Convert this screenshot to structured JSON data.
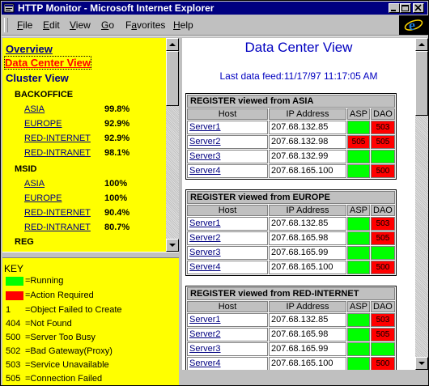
{
  "window": {
    "title": "HTTP Monitor - Microsoft Internet Explorer"
  },
  "menubar": {
    "items": [
      "File",
      "Edit",
      "View",
      "Go",
      "Favorites",
      "Help"
    ]
  },
  "nav": {
    "overview": "Overview",
    "datacenter": "Data Center View",
    "cluster": "Cluster View",
    "groups": [
      {
        "name": "BACKOFFICE",
        "rows": [
          {
            "label": "ASIA",
            "pct": "99.8%"
          },
          {
            "label": "EUROPE",
            "pct": "92.9%"
          },
          {
            "label": "RED-INTERNET",
            "pct": "92.9%"
          },
          {
            "label": "RED-INTRANET",
            "pct": "98.1%"
          }
        ]
      },
      {
        "name": "MSID",
        "rows": [
          {
            "label": "ASIA",
            "pct": "100%"
          },
          {
            "label": "EUROPE",
            "pct": "100%"
          },
          {
            "label": "RED-INTERNET",
            "pct": "90.4%"
          },
          {
            "label": "RED-INTRANET",
            "pct": "80.7%"
          }
        ]
      }
    ],
    "last_group": "REG"
  },
  "key": {
    "title": "KEY",
    "running": "=Running",
    "action": "=Action Required",
    "codes": [
      {
        "code": "1",
        "text": "=Object Failed to Create"
      },
      {
        "code": "404",
        "text": "=Not Found"
      },
      {
        "code": "500",
        "text": "=Server Too Busy"
      },
      {
        "code": "502",
        "text": "=Bad Gateway(Proxy)"
      },
      {
        "code": "503",
        "text": "=Service Unavailable"
      },
      {
        "code": "505",
        "text": "=Connection Failed"
      }
    ]
  },
  "colors": {
    "running": "#00ff00",
    "action": "#ff0000",
    "nav_bg": "#ffff00"
  },
  "main": {
    "title": "Data Center View",
    "feed": "Last data feed:11/17/97 11:17:05 AM",
    "headers": [
      "Host",
      "IP Address",
      "ASP",
      "DAO"
    ],
    "tables": [
      {
        "caption": "REGISTER viewed from ASIA",
        "rows": [
          {
            "host": "Server1",
            "ip": "207.68.132.85",
            "asp": "",
            "asp_state": "running",
            "dao": "503",
            "dao_state": "action"
          },
          {
            "host": "Server2",
            "ip": "207.68.132.98",
            "asp": "505",
            "asp_state": "action",
            "dao": "505",
            "dao_state": "action"
          },
          {
            "host": "Server3",
            "ip": "207.68.132.99",
            "asp": "",
            "asp_state": "running",
            "dao": "",
            "dao_state": "running"
          },
          {
            "host": "Server4",
            "ip": "207.68.165.100",
            "asp": "",
            "asp_state": "running",
            "dao": "500",
            "dao_state": "action"
          }
        ]
      },
      {
        "caption": "REGISTER viewed from EUROPE",
        "rows": [
          {
            "host": "Server1",
            "ip": "207.68.132.85",
            "asp": "",
            "asp_state": "running",
            "dao": "503",
            "dao_state": "action"
          },
          {
            "host": "Server2",
            "ip": "207.68.165.98",
            "asp": "",
            "asp_state": "running",
            "dao": "505",
            "dao_state": "action"
          },
          {
            "host": "Server3",
            "ip": "207.68.165.99",
            "asp": "",
            "asp_state": "running",
            "dao": "",
            "dao_state": "running"
          },
          {
            "host": "Server4",
            "ip": "207.68.165.100",
            "asp": "",
            "asp_state": "running",
            "dao": "500",
            "dao_state": "action"
          }
        ]
      },
      {
        "caption": "REGISTER viewed from RED-INTERNET",
        "rows": [
          {
            "host": "Server1",
            "ip": "207.68.132.85",
            "asp": "",
            "asp_state": "running",
            "dao": "503",
            "dao_state": "action"
          },
          {
            "host": "Server2",
            "ip": "207.68.165.98",
            "asp": "",
            "asp_state": "running",
            "dao": "505",
            "dao_state": "action"
          },
          {
            "host": "Server3",
            "ip": "207.68.165.99",
            "asp": "",
            "asp_state": "running",
            "dao": "",
            "dao_state": "running"
          },
          {
            "host": "Server4",
            "ip": "207.68.165.100",
            "asp": "",
            "asp_state": "running",
            "dao": "500",
            "dao_state": "action"
          }
        ]
      }
    ]
  }
}
